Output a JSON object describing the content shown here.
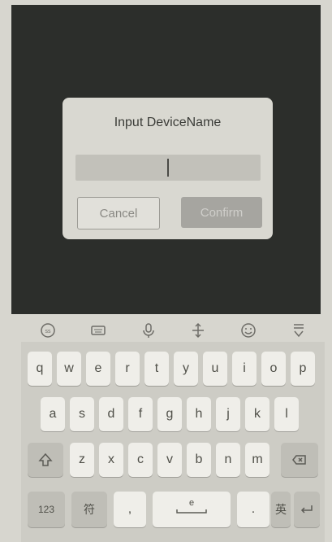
{
  "dialog": {
    "title": "Input DeviceName",
    "input_value": "",
    "cancel_label": "Cancel",
    "confirm_label": "Confirm"
  },
  "toolbar": {
    "icons": [
      "emoji-icon",
      "keyboard-icon",
      "microphone-icon",
      "cursor-move-icon",
      "smiley-icon",
      "hide-keyboard-icon"
    ]
  },
  "keyboard": {
    "row1": [
      "q",
      "w",
      "e",
      "r",
      "t",
      "y",
      "u",
      "i",
      "o",
      "p"
    ],
    "row2": [
      "a",
      "s",
      "d",
      "f",
      "g",
      "h",
      "j",
      "k",
      "l"
    ],
    "row3": [
      "z",
      "x",
      "c",
      "v",
      "b",
      "n",
      "m"
    ],
    "numbers_key": "123",
    "symbols_key": "符",
    "comma_key": ",",
    "space_hint": "e",
    "period_key": ".",
    "lang_key": "英"
  },
  "colors": {
    "screen_bg": "#2c2e2b",
    "dialog_bg": "#d9d8d1",
    "keyboard_bg": "#cdccc5",
    "key_bg": "#efeee9"
  }
}
